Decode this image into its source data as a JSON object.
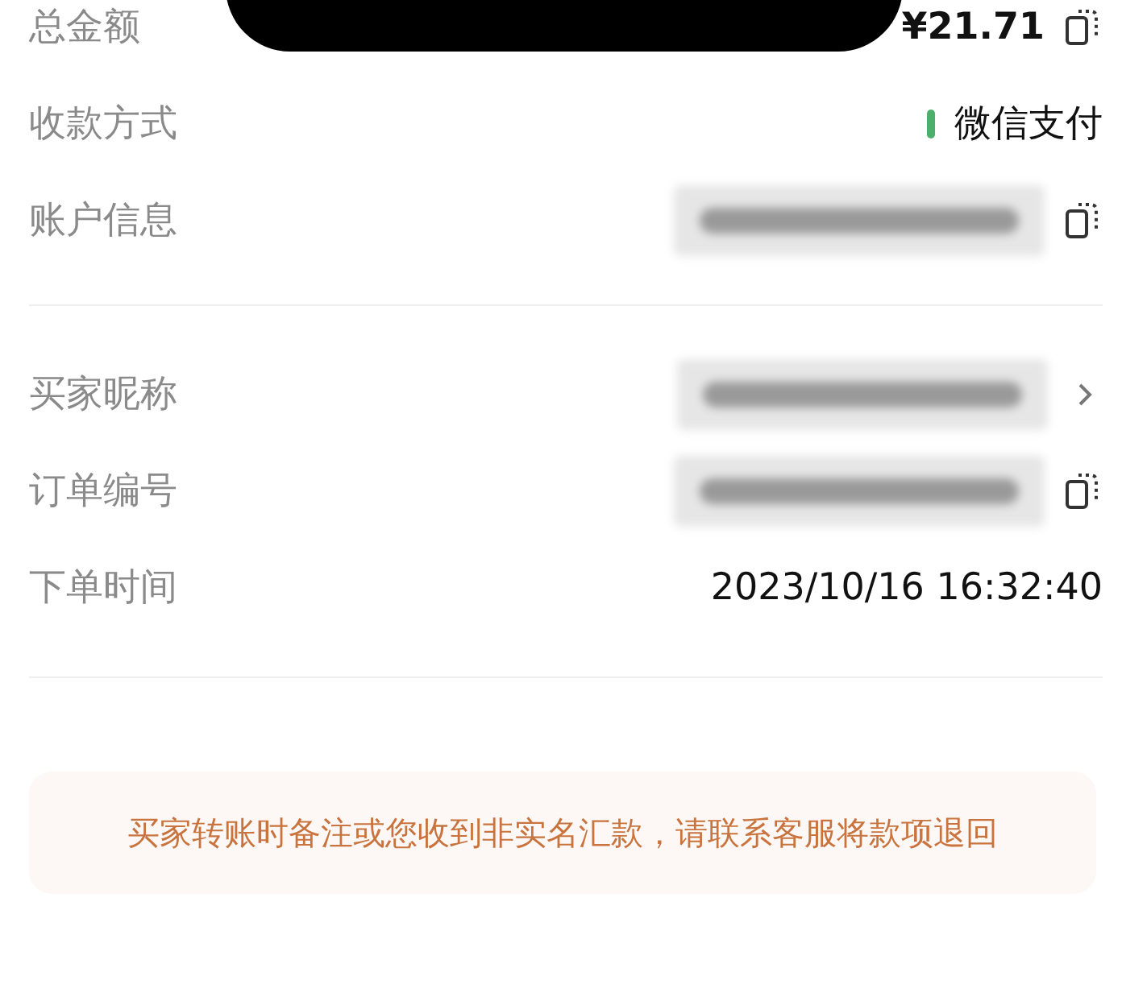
{
  "sections": [
    {
      "rows": [
        {
          "label": "总金额",
          "kind": "text",
          "value": "¥21.71",
          "bold": true,
          "indicator": false,
          "trailing": {
            "kind": "copy"
          }
        },
        {
          "label": "收款方式",
          "kind": "text",
          "value": "微信支付",
          "bold": false,
          "indicator": true
        },
        {
          "label": "账户信息",
          "kind": "redacted",
          "indicator": false,
          "trailing": {
            "kind": "copy"
          }
        }
      ]
    },
    {
      "rows": [
        {
          "label": "买家昵称",
          "kind": "redacted",
          "indicator": false,
          "trailing": {
            "kind": "chevron"
          }
        },
        {
          "label": "订单编号",
          "kind": "redacted",
          "indicator": false,
          "trailing": {
            "kind": "copy"
          }
        },
        {
          "label": "下单时间",
          "kind": "text",
          "value": "2023/10/16 16:32:40",
          "bold": false,
          "indicator": false
        }
      ]
    }
  ],
  "notice": "买家转账时备注或您收到非实名汇款，请联系客服将款项退回"
}
